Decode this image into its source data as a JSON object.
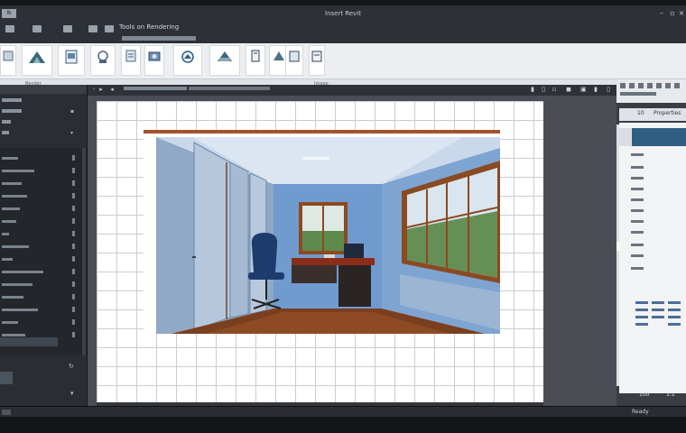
{
  "app": {
    "logo_text": "Ik",
    "window_title": "Insert Revit"
  },
  "menu": {
    "items": [
      {
        "icon": "app-menu-icon",
        "label": ""
      },
      {
        "icon": "folder-icon",
        "label": ""
      },
      {
        "icon": "save-icon",
        "label": ""
      },
      {
        "icon": "print-icon",
        "label": ""
      },
      {
        "icon": "undo-icon",
        "label": ""
      }
    ],
    "title_text": "Tools on Rendering"
  },
  "ribbon": {
    "buttons": [
      {
        "icon": "image-icon",
        "label": ""
      },
      {
        "icon": "mountain-icon",
        "label": ""
      },
      {
        "icon": "gallery-icon",
        "label": ""
      },
      {
        "icon": "user-icon",
        "label": ""
      },
      {
        "icon": "document-icon",
        "label": ""
      },
      {
        "icon": "camera-icon",
        "label": ""
      },
      {
        "icon": "landscape-icon",
        "label": ""
      },
      {
        "icon": "page-icon",
        "label": ""
      },
      {
        "icon": "doc-icon",
        "label": ""
      },
      {
        "icon": "mountain-icon",
        "label": ""
      },
      {
        "icon": "sheet-icon",
        "label": ""
      }
    ],
    "group_label_left": "Render",
    "group_label_right": "Image"
  },
  "view": {
    "toolbar_icons": [
      "zoom-icon",
      "pan-icon",
      "orbit-icon",
      "section-icon",
      "fit-icon",
      "camera-icon",
      "render-icon",
      "help-icon",
      "settings-icon"
    ],
    "image_alt": "Rendered office interior"
  },
  "right_panel": {
    "tab_a": "10",
    "tab_b": "Properties",
    "footer_left": "100",
    "footer_right": "1:1"
  },
  "status": {
    "right_text": "Ready"
  },
  "colors": {
    "accent": "#2f5e83",
    "ribbon_bg": "#eceef1",
    "canvas_bg": "#4a4d53"
  }
}
